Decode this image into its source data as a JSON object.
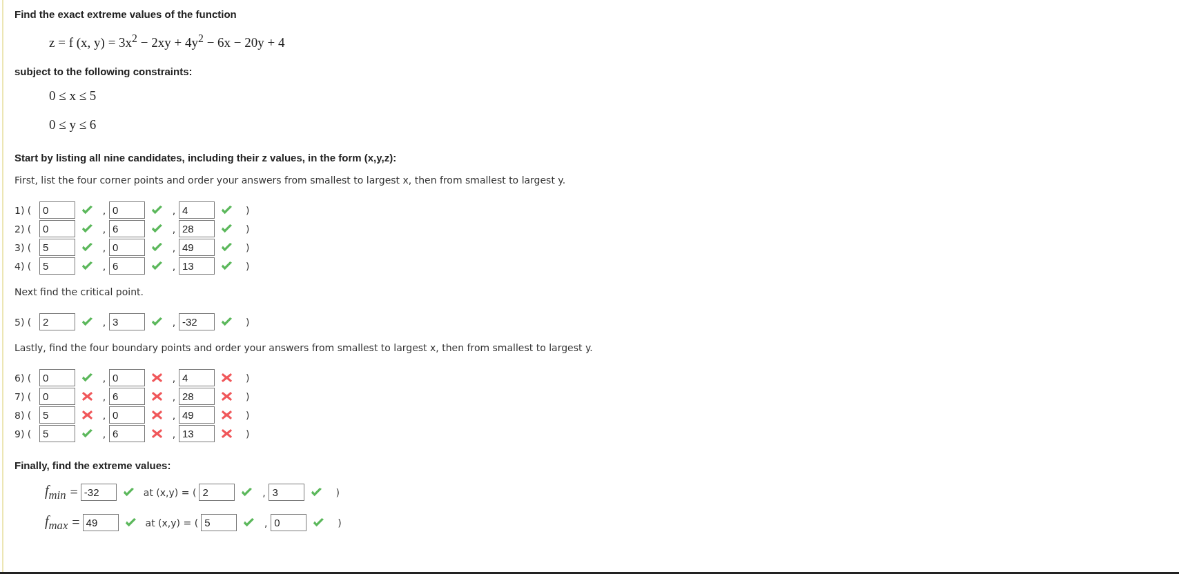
{
  "intro": "Find the exact extreme values of the function",
  "function": "z = f (x, y) = 3x$^{2}$ − 2xy + 4y$^{2}$ − 6x − 20y + 4",
  "constraints_label": "subject to the following constraints:",
  "constraints": [
    "0 ≤ x ≤ 5",
    "0 ≤ y ≤ 6"
  ],
  "blocks": [
    {
      "kind": "heading",
      "text": "Start by listing all nine candidates, including their z values, in the form (x,y,z):"
    },
    {
      "kind": "instruction",
      "text": "First, list the four corner points and order your answers from smallest to largest x, then from smallest to largest y."
    },
    {
      "kind": "answers",
      "rows": [
        {
          "label": "1) (",
          "fields": [
            {
              "value": "0",
              "correct": true
            },
            {
              "prefix": ",",
              "value": "0",
              "correct": true
            },
            {
              "prefix": ",",
              "value": "4",
              "correct": true
            }
          ],
          "close": ")"
        },
        {
          "label": "2) (",
          "fields": [
            {
              "value": "0",
              "correct": true
            },
            {
              "prefix": ",",
              "value": "6",
              "correct": true
            },
            {
              "prefix": ",",
              "value": "28",
              "correct": true
            }
          ],
          "close": ")"
        },
        {
          "label": "3) (",
          "fields": [
            {
              "value": "5",
              "correct": true
            },
            {
              "prefix": ",",
              "value": "0",
              "correct": true
            },
            {
              "prefix": ",",
              "value": "49",
              "correct": true
            }
          ],
          "close": ")"
        },
        {
          "label": "4) (",
          "fields": [
            {
              "value": "5",
              "correct": true
            },
            {
              "prefix": ",",
              "value": "6",
              "correct": true
            },
            {
              "prefix": ",",
              "value": "13",
              "correct": true
            }
          ],
          "close": ")"
        }
      ]
    },
    {
      "kind": "instruction",
      "text": "Next find the critical point."
    },
    {
      "kind": "answers",
      "rows": [
        {
          "label": "5) (",
          "fields": [
            {
              "value": "2",
              "correct": true
            },
            {
              "prefix": ",",
              "value": "3",
              "correct": true
            },
            {
              "prefix": ",",
              "value": "-32",
              "correct": true
            }
          ],
          "close": ")"
        }
      ]
    },
    {
      "kind": "instruction",
      "text": "Lastly, find the four boundary points and order your answers from smallest to largest x, then from smallest to largest y."
    },
    {
      "kind": "answers",
      "rows": [
        {
          "label": "6) (",
          "fields": [
            {
              "value": "0",
              "correct": true
            },
            {
              "prefix": ",",
              "value": "0",
              "correct": false
            },
            {
              "prefix": ",",
              "value": "4",
              "correct": false
            }
          ],
          "close": ")"
        },
        {
          "label": "7) (",
          "fields": [
            {
              "value": "0",
              "correct": false
            },
            {
              "prefix": ",",
              "value": "6",
              "correct": false
            },
            {
              "prefix": ",",
              "value": "28",
              "correct": false
            }
          ],
          "close": ")"
        },
        {
          "label": "8) (",
          "fields": [
            {
              "value": "5",
              "correct": false
            },
            {
              "prefix": ",",
              "value": "0",
              "correct": false
            },
            {
              "prefix": ",",
              "value": "49",
              "correct": false
            }
          ],
          "close": ")"
        },
        {
          "label": "9) (",
          "fields": [
            {
              "value": "5",
              "correct": true
            },
            {
              "prefix": ",",
              "value": "6",
              "correct": false
            },
            {
              "prefix": ",",
              "value": "13",
              "correct": false
            }
          ],
          "close": ")"
        }
      ]
    },
    {
      "kind": "heading",
      "text": "Finally, find the extreme values:"
    }
  ],
  "extremes": [
    {
      "name": "f$_{min}$",
      "equals": "=",
      "value": "-32",
      "correct": true,
      "at": "at (x,y) = (",
      "fields": [
        {
          "value": "2",
          "correct": true
        },
        {
          "prefix": ",",
          "value": "3",
          "correct": true
        }
      ],
      "close": ")"
    },
    {
      "name": "f$_{max}$",
      "equals": "=",
      "value": "49",
      "correct": true,
      "at": "at (x,y) = (",
      "fields": [
        {
          "value": "5",
          "correct": true
        },
        {
          "prefix": ",",
          "value": "0",
          "correct": true
        }
      ],
      "close": ")"
    }
  ]
}
